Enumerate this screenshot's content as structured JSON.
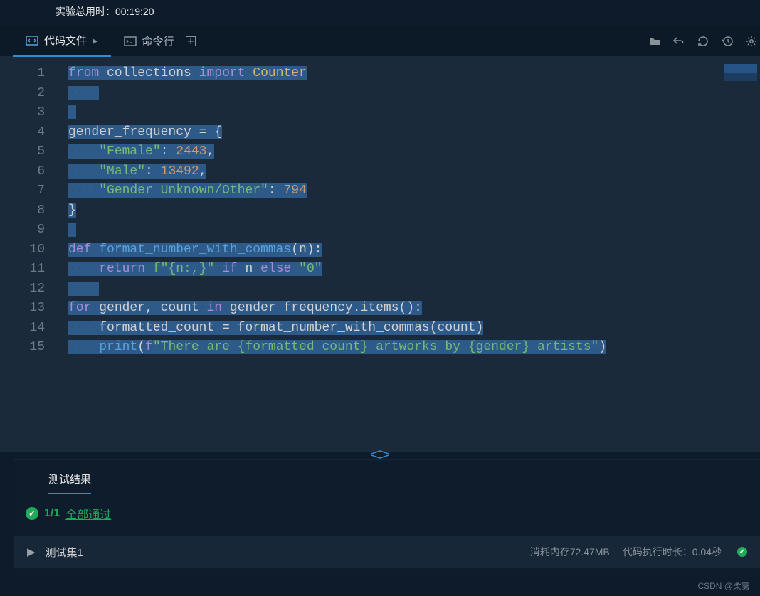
{
  "header": {
    "timer_label": "实验总用时：",
    "timer_value": "00:19:20"
  },
  "tabs": {
    "code_file": "代码文件",
    "command_line": "命令行"
  },
  "code": {
    "lines": [
      {
        "n": "1"
      },
      {
        "n": "2"
      },
      {
        "n": "3"
      },
      {
        "n": "4"
      },
      {
        "n": "5"
      },
      {
        "n": "6"
      },
      {
        "n": "7"
      },
      {
        "n": "8"
      },
      {
        "n": "9"
      },
      {
        "n": "10"
      },
      {
        "n": "11"
      },
      {
        "n": "12"
      },
      {
        "n": "13"
      },
      {
        "n": "14"
      },
      {
        "n": "15"
      }
    ],
    "l1": {
      "kw1": "from",
      "mod": "collections",
      "kw2": "import",
      "cls": "Counter"
    },
    "l4": {
      "id": "gender_frequency",
      "op": " = {"
    },
    "l5": {
      "str": "\"Female\"",
      "colon": ": ",
      "num": "2443",
      "comma": ","
    },
    "l6": {
      "str": "\"Male\"",
      "colon": ": ",
      "num": "13492",
      "comma": ","
    },
    "l7": {
      "str": "\"Gender Unknown/Other\"",
      "colon": ": ",
      "num": "794"
    },
    "l8": {
      "close": "}"
    },
    "l10": {
      "kw": "def",
      "fn": "format_number_with_commas",
      "sig": "(n):"
    },
    "l11": {
      "kw": "return",
      "str1": "f\"{n:,}\"",
      "kw2": "if",
      "id": "n",
      "kw3": "else",
      "str2": "\"0\""
    },
    "l13": {
      "kw": "for",
      "vars": "gender, count",
      "kw2": "in",
      "call": "gender_frequency.items():"
    },
    "l14": {
      "lhs": "formatted_count = format_number_with_commas(count)"
    },
    "l15": {
      "fn": "print",
      "open": "(",
      "pfx": "f",
      "str": "\"There are {formatted_count} artworks by {gender} artists\"",
      "close": ")"
    }
  },
  "results": {
    "tab_label": "测试结果",
    "score": "1/1",
    "passed_label": "全部通过",
    "testcase_label": "测试集1",
    "memory": "消耗内存72.47MB",
    "time": "代码执行时长：0.04秒"
  },
  "watermark": "CSDN @柔雾"
}
